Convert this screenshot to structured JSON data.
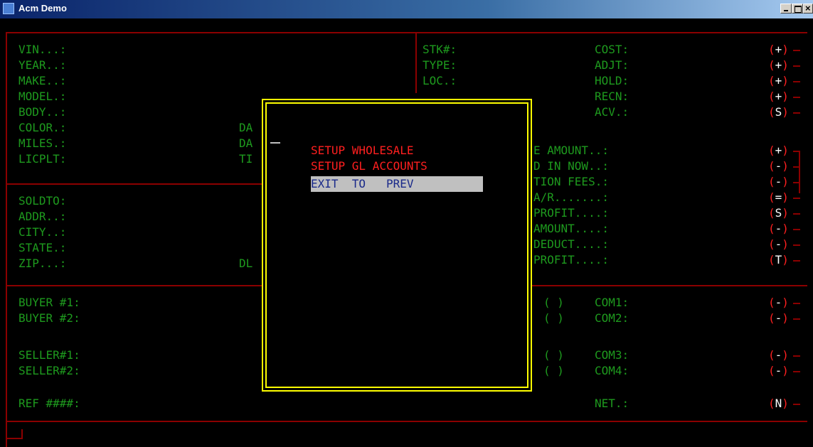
{
  "window": {
    "title": "Acm Demo"
  },
  "vehicle_left": [
    "VIN...:",
    "YEAR..:",
    "MAKE..:",
    "MODEL.:",
    "BODY..:",
    "COLOR.:",
    "MILES.:",
    "LICPLT:"
  ],
  "vehicle_mid_codes": [
    "DA",
    "DA",
    "TI"
  ],
  "stock_fields": [
    "STK#:",
    "TYPE:",
    "LOC.:"
  ],
  "cost_fields": [
    "COST:",
    "ADJT:",
    "HOLD:",
    "RECN:",
    "ACV.:"
  ],
  "cost_indicators": [
    "+",
    "+",
    "+",
    "+",
    "S"
  ],
  "customer_fields": [
    "SOLDTO:",
    "ADDR..:",
    "CITY..:",
    "STATE.:",
    "ZIP...:"
  ],
  "customer_mid_code": "DL",
  "deal_fields": [
    "E AMOUNT..:",
    "D IN NOW..:",
    "TION FEES.:",
    "A/R.......:",
    "PROFIT....:",
    "AMOUNT....:",
    "DEDUCT....:",
    "PROFIT....:"
  ],
  "deal_indicators": [
    "+",
    "-",
    "-",
    "=",
    "S",
    "-",
    "-",
    "T"
  ],
  "commission_parties": [
    "BUYER #1:",
    "BUYER #2:",
    "SELLER#1:",
    "SELLER#2:"
  ],
  "commission_checks": [
    "( )",
    "( )",
    "( )",
    "( )"
  ],
  "commission_fields": [
    "COM1:",
    "COM2:",
    "COM3:",
    "COM4:"
  ],
  "commission_indicators": [
    "-",
    "-",
    "-",
    "-"
  ],
  "ref_label": "REF ####:",
  "net_label": "NET.:",
  "net_indicator": "N",
  "menu": {
    "items": [
      "SETUP WHOLESALE",
      "SETUP GL ACCOUNTS",
      "EXIT  TO   PREV"
    ],
    "selected_index": 2
  },
  "colors": {
    "label": "#1e9a1e",
    "border": "#8b0000",
    "menu": "#ff1f1f",
    "modal_border": "#ffff00",
    "indicator": "#ffffff"
  }
}
